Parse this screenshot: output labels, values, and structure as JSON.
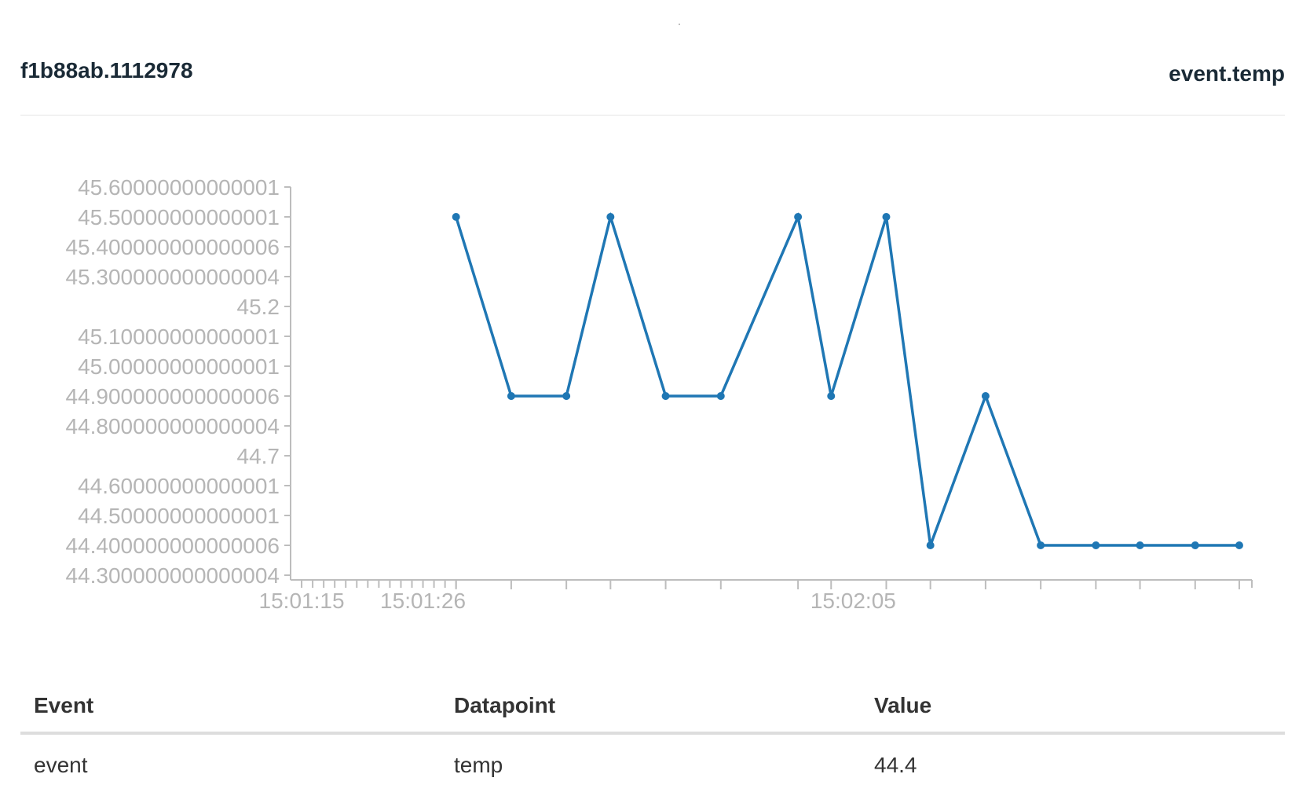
{
  "header": {
    "device_id": "f1b88ab.1112978",
    "metric": "event.temp"
  },
  "colors": {
    "line": "#1f77b4",
    "axis": "#bdbdbd",
    "tick_text": "#b5b5b5"
  },
  "chart_data": {
    "type": "line",
    "title": "",
    "xlabel": "",
    "ylabel": "",
    "ylim": [
      44.300000000000004,
      45.60000000000001
    ],
    "yticks": [
      "45.60000000000001",
      "45.50000000000001",
      "45.400000000000006",
      "45.300000000000004",
      "45.2",
      "45.10000000000001",
      "45.00000000000001",
      "44.900000000000006",
      "44.800000000000004",
      "44.7",
      "44.60000000000001",
      "44.50000000000001",
      "44.400000000000006",
      "44.300000000000004"
    ],
    "xlim": [
      "15:01:14",
      "15:02:41"
    ],
    "xtick_labels": [
      "15:01:15",
      "15:01:26",
      "15:02:05"
    ],
    "series": [
      {
        "x": [
          "15:01:29",
          "15:01:34",
          "15:01:39",
          "15:01:43",
          "15:01:48",
          "15:01:53",
          "15:02:00",
          "15:02:03",
          "15:02:08",
          "15:02:12",
          "15:02:17",
          "15:02:22",
          "15:02:27",
          "15:02:31",
          "15:02:36",
          "15:02:40"
        ],
        "values": [
          45.5,
          44.9,
          44.9,
          45.5,
          44.9,
          44.9,
          45.5,
          44.9,
          45.5,
          44.4,
          44.9,
          44.4,
          44.4,
          44.4,
          44.4,
          44.4
        ]
      }
    ]
  },
  "table": {
    "headers": [
      "Event",
      "Datapoint",
      "Value"
    ],
    "rows": [
      [
        "event",
        "temp",
        "44.4"
      ]
    ]
  }
}
